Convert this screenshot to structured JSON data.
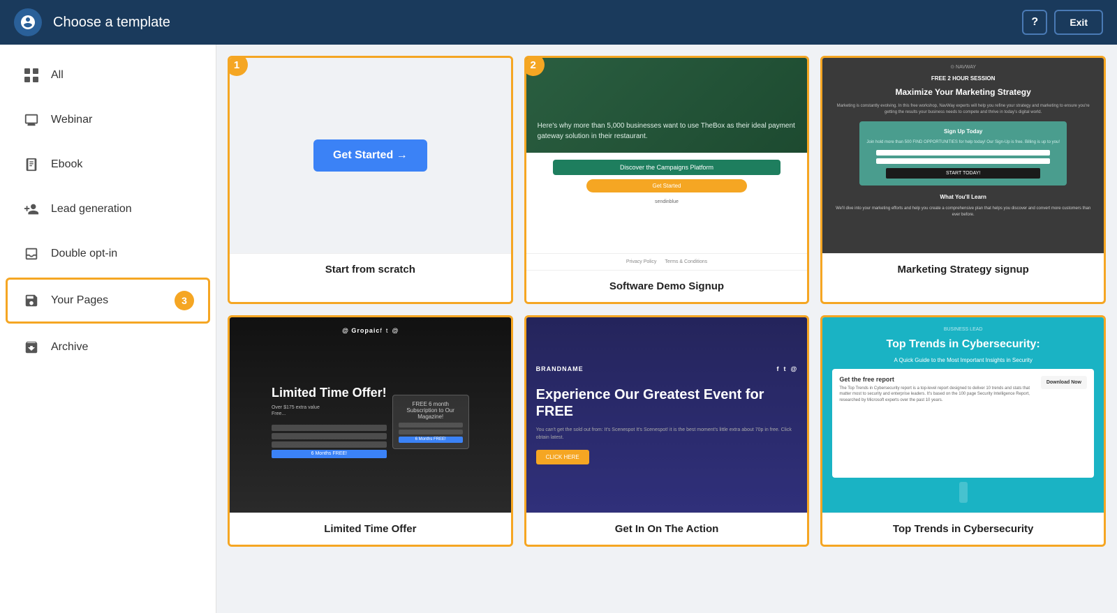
{
  "header": {
    "title": "Choose a template",
    "help_label": "?",
    "exit_label": "Exit"
  },
  "sidebar": {
    "items": [
      {
        "id": "all",
        "label": "All",
        "icon": "grid",
        "active": false,
        "badge": null
      },
      {
        "id": "webinar",
        "label": "Webinar",
        "icon": "monitor",
        "active": false,
        "badge": null
      },
      {
        "id": "ebook",
        "label": "Ebook",
        "icon": "book",
        "active": false,
        "badge": null
      },
      {
        "id": "lead-generation",
        "label": "Lead generation",
        "icon": "user-plus",
        "active": false,
        "badge": null
      },
      {
        "id": "double-opt-in",
        "label": "Double opt-in",
        "icon": "inbox",
        "active": false,
        "badge": null
      },
      {
        "id": "your-pages",
        "label": "Your Pages",
        "icon": "save",
        "active": true,
        "badge": "3"
      },
      {
        "id": "archive",
        "label": "Archive",
        "icon": "archive",
        "active": false,
        "badge": null
      }
    ]
  },
  "templates": {
    "cards": [
      {
        "id": "scratch",
        "label": "Start from scratch",
        "badge": "1",
        "type": "scratch",
        "bordered": true
      },
      {
        "id": "software-demo",
        "label": "Software Demo Signup",
        "badge": "2",
        "type": "software-demo",
        "bordered": true
      },
      {
        "id": "marketing-strategy",
        "label": "Marketing Strategy signup",
        "badge": null,
        "type": "marketing-strategy",
        "bordered": true
      },
      {
        "id": "limited-offer",
        "label": "Limited Time Offer",
        "badge": null,
        "type": "limited-offer",
        "bordered": true
      },
      {
        "id": "event",
        "label": "Get In On The Action",
        "badge": null,
        "type": "event",
        "bordered": true
      },
      {
        "id": "cybersecurity",
        "label": "Top Trends in Cybersecurity",
        "badge": null,
        "type": "cybersecurity",
        "bordered": true
      }
    ],
    "get_started_label": "Get Started →"
  }
}
